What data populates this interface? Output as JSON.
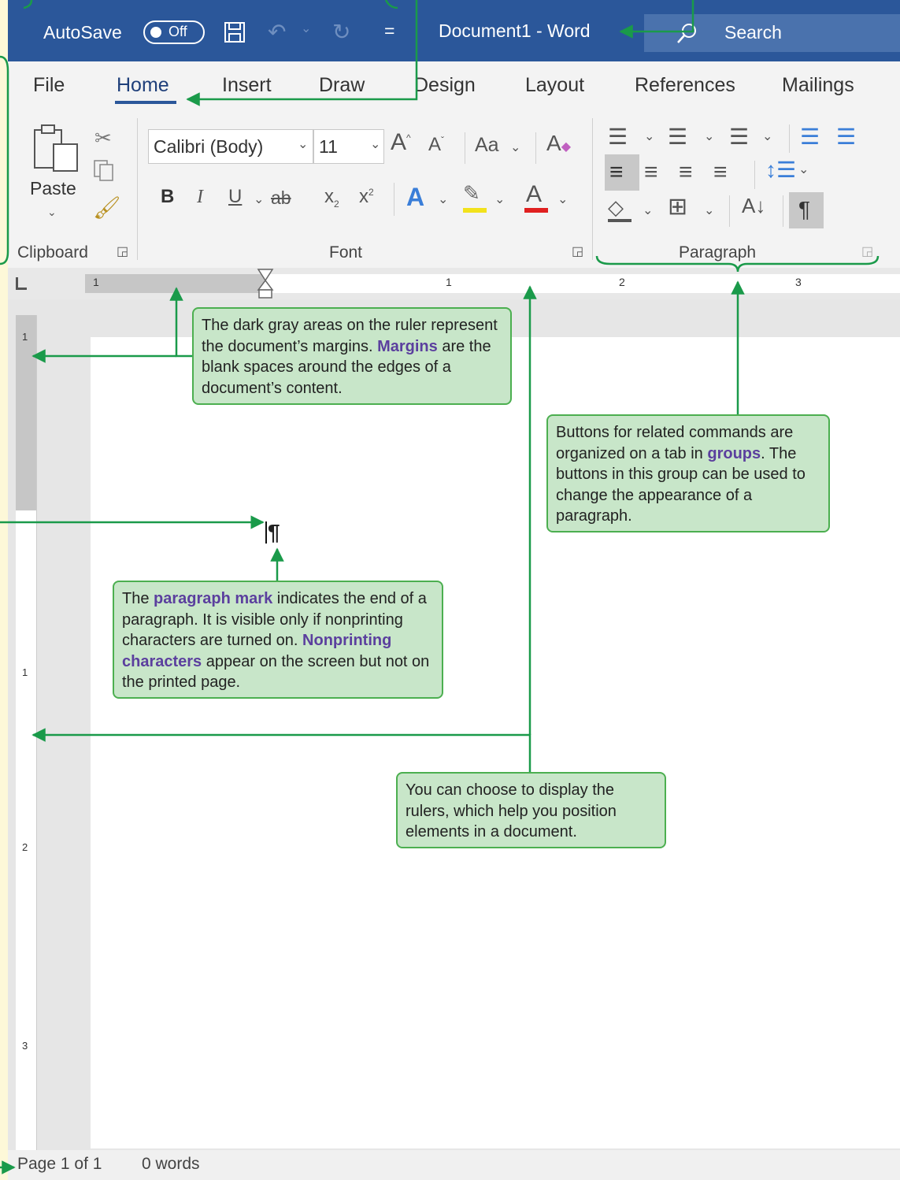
{
  "titlebar": {
    "autosave_label": "AutoSave",
    "autosave_state": "Off",
    "qat_more": "=",
    "document_title": "Document1 - Word",
    "search_label": "Search"
  },
  "ribbon": {
    "tabs": [
      "File",
      "Home",
      "Insert",
      "Draw",
      "Design",
      "Layout",
      "References",
      "Mailings"
    ],
    "active_tab": "Home",
    "clipboard": {
      "paste_label": "Paste",
      "group_label": "Clipboard"
    },
    "font": {
      "font_name": "Calibri (Body)",
      "font_size": "11",
      "case_label": "Aa",
      "bold": "B",
      "italic": "I",
      "underline": "U",
      "strike": "ab",
      "subscript": "x",
      "superscript": "x",
      "group_label": "Font"
    },
    "paragraph": {
      "group_label": "Paragraph",
      "pilcrow": "¶"
    }
  },
  "ruler": {
    "h_numbers": [
      "1",
      "1",
      "2",
      "3"
    ],
    "v_numbers": [
      "1",
      "1",
      "2",
      "3"
    ]
  },
  "document": {
    "paragraph_mark": "¶"
  },
  "status": {
    "page": "Page 1 of 1",
    "words": "0 words"
  },
  "callouts": {
    "margins": {
      "t1": "The dark gray areas on the ruler represent the document’s margins.",
      "k1": "Margins",
      "t2": "are the blank spaces around the edges of a document’s content."
    },
    "groups": {
      "t1": "Buttons for related commands are organized on a tab in",
      "k1": "groups",
      "t2": ". The buttons in this group can be used to change the appearance of a paragraph."
    },
    "paragraph_mark": {
      "t1": "The",
      "k1": "paragraph mark",
      "t2": "indicates the end of a paragraph. It is visible only if nonprinting characters are turned on.",
      "k2": "Nonprinting characters",
      "t3": "appear on the screen but not on the printed page."
    },
    "rulers": {
      "t1": "You can choose to display the rulers, which help you position elements in a document."
    }
  },
  "colors": {
    "title_bar": "#2b579a",
    "callout_fill": "#c8e6c9",
    "callout_border": "#4caf50",
    "arrow": "#1a9a4a",
    "keyword": "#5b3f9e"
  }
}
